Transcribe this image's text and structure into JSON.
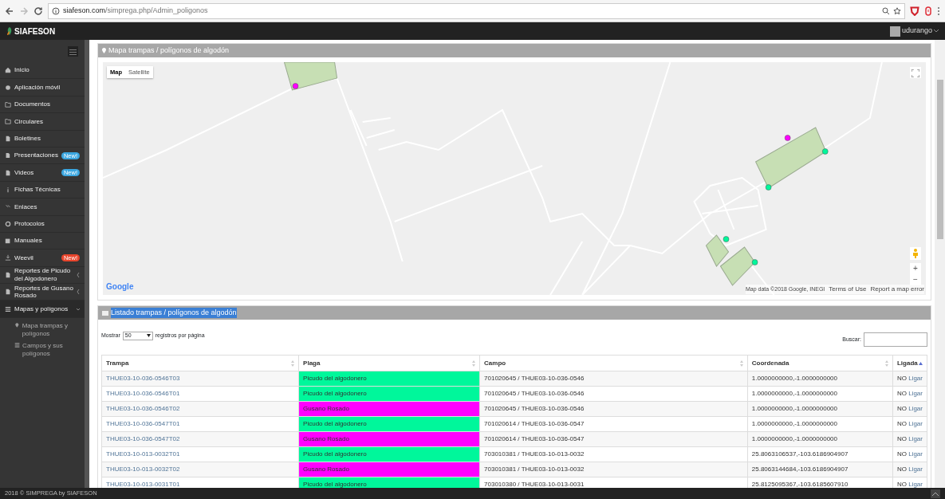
{
  "browser": {
    "url_host": "siafeson.com",
    "url_path": "/simprega.php/Admin_poligonos",
    "forward_disabled": true
  },
  "navbar": {
    "brand": "SIAFESON",
    "user": "udurango"
  },
  "sidebar": {
    "items": [
      {
        "kind": "home",
        "label": "Inicio"
      },
      {
        "kind": "phone",
        "label": "Aplicación móvil"
      },
      {
        "kind": "folder",
        "label": "Documentos"
      },
      {
        "kind": "folder",
        "label": "Circulares"
      },
      {
        "kind": "file",
        "label": "Boletines"
      },
      {
        "kind": "file",
        "label": "Presentaciones",
        "badge": "New!",
        "color": "#3aa6e0"
      },
      {
        "kind": "file",
        "label": "Videos",
        "badge": "New!",
        "color": "#3aa6e0"
      },
      {
        "kind": "info",
        "label": "Fichas Técnicas"
      },
      {
        "kind": "link",
        "label": "Enlaces"
      },
      {
        "kind": "gear",
        "label": "Protocolos"
      },
      {
        "kind": "book",
        "label": "Manuales"
      },
      {
        "kind": "download",
        "label": "Weevil",
        "badge": "New!",
        "color": "#e8452c"
      },
      {
        "kind": "file",
        "label": "Reportes de Picudo del Algodonero",
        "expanded": false
      },
      {
        "kind": "file",
        "label": "Reportes de Gusano Rosado",
        "expanded": false
      },
      {
        "kind": "list",
        "label": "Mapas y polígonos",
        "expanded": true,
        "children": [
          {
            "kind": "pin",
            "label": "Mapa trampas y polígonos"
          },
          {
            "kind": "list",
            "label": "Campos y sus polígonos"
          }
        ]
      }
    ]
  },
  "map_panel": {
    "title": "Mapa trampas / polígonos de algodón",
    "map_types": [
      {
        "label": "Map",
        "selected": true
      },
      {
        "label": "Satellite",
        "selected": false
      }
    ],
    "logo": "Google",
    "attribution": "Map data ©2018 Google, INEGI",
    "terms": "Terms of Use",
    "report": "Report a map error",
    "zoom_in": "+",
    "zoom_out": "−"
  },
  "list_panel": {
    "title": "Listado trampas / polígonos de algodón",
    "title_selected": true,
    "show_label": "Mostrar",
    "page_size": "50",
    "per_page_label": "registros por página",
    "search_label": "Buscar:",
    "columns": [
      {
        "label": "Trampa",
        "sorted": false
      },
      {
        "label": "Plaga",
        "sorted": false
      },
      {
        "label": "Campo",
        "sorted": false
      },
      {
        "label": "Coordenada",
        "sorted": false
      },
      {
        "label": "Ligada",
        "sorted": true
      }
    ],
    "rows": [
      {
        "trampa": "THUE03-10-036-0546T03",
        "plaga": "Picudo del algodonero",
        "color": "#00f79b",
        "campo": "701020645 / THUE03-10-036-0546",
        "coordenada": "1.0000000000,-1.0000000000",
        "ligada": "NO",
        "action": "Ligar"
      },
      {
        "trampa": "THUE03-10-036-0546T01",
        "plaga": "Picudo del algodonero",
        "color": "#00f79b",
        "campo": "701020645 / THUE03-10-036-0546",
        "coordenada": "1.0000000000,-1.0000000000",
        "ligada": "NO",
        "action": "Ligar"
      },
      {
        "trampa": "THUE03-10-036-0546T02",
        "plaga": "Gusano Rosado",
        "color": "#ff00ff",
        "campo": "701020645 / THUE03-10-036-0546",
        "coordenada": "1.0000000000,-1.0000000000",
        "ligada": "NO",
        "action": "Ligar"
      },
      {
        "trampa": "THUE03-10-036-0547T01",
        "plaga": "Picudo del algodonero",
        "color": "#00f79b",
        "campo": "701020614 / THUE03-10-036-0547",
        "coordenada": "1.0000000000,-1.0000000000",
        "ligada": "NO",
        "action": "Ligar"
      },
      {
        "trampa": "THUE03-10-036-0547T02",
        "plaga": "Gusano Rosado",
        "color": "#ff00ff",
        "campo": "701020614 / THUE03-10-036-0547",
        "coordenada": "1.0000000000,-1.0000000000",
        "ligada": "NO",
        "action": "Ligar"
      },
      {
        "trampa": "THUE03-10-013-0032T01",
        "plaga": "Picudo del algodonero",
        "color": "#00f79b",
        "campo": "703010381 / THUE03-10-013-0032",
        "coordenada": "25.8063106537,-103.6186904907",
        "ligada": "NO",
        "action": "Ligar"
      },
      {
        "trampa": "THUE03-10-013-0032T02",
        "plaga": "Gusano Rosado",
        "color": "#ff00ff",
        "campo": "703010381 / THUE03-10-013-0032",
        "coordenada": "25.8063144684,-103.6186904907",
        "ligada": "NO",
        "action": "Ligar"
      },
      {
        "trampa": "THUE03-10-013-0031T01",
        "plaga": "Picudo del algodonero",
        "color": "#00f79b",
        "campo": "703010380 / THUE03-10-013-0031",
        "coordenada": "25.8125095367,-103.6185607910",
        "ligada": "NO",
        "action": "Ligar"
      }
    ]
  },
  "footer": {
    "text": "2018 © SIMPREGA by SIAFESON"
  }
}
